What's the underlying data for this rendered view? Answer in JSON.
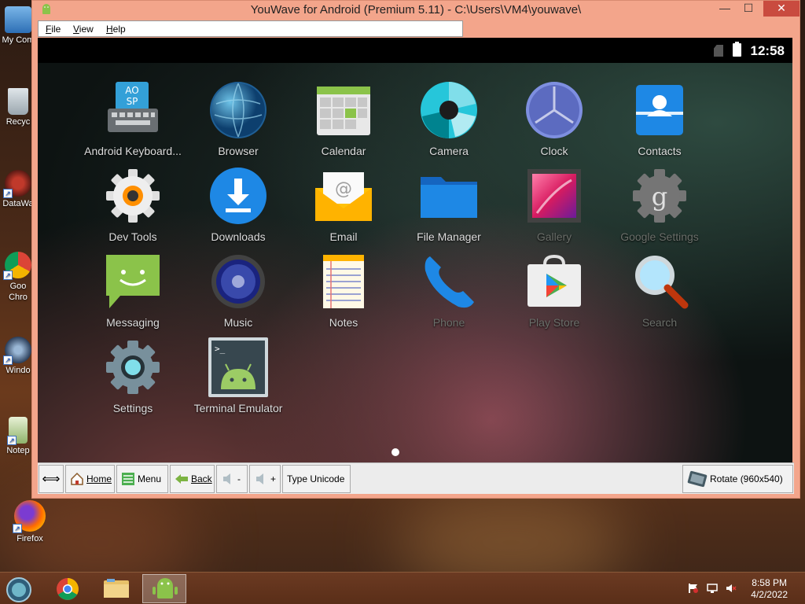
{
  "window": {
    "title": "YouWave for Android (Premium 5.11) - C:\\Users\\VM4\\youwave\\",
    "min_symbol": "—",
    "max_symbol": "☐",
    "close_symbol": "✕"
  },
  "menu": {
    "items": [
      {
        "label": "File",
        "accel": "F",
        "rest": "ile"
      },
      {
        "label": "View",
        "accel": "V",
        "rest": "iew"
      },
      {
        "label": "Help",
        "accel": "H",
        "rest": "elp"
      }
    ]
  },
  "status_bar": {
    "time": "12:58"
  },
  "apps": [
    {
      "label": "Android Keyboard...",
      "icon": "keyboard-icon",
      "dim": false
    },
    {
      "label": "Browser",
      "icon": "globe-icon",
      "dim": false
    },
    {
      "label": "Calendar",
      "icon": "calendar-icon",
      "dim": false
    },
    {
      "label": "Camera",
      "icon": "camera-icon",
      "dim": false
    },
    {
      "label": "Clock",
      "icon": "clock-icon",
      "dim": false
    },
    {
      "label": "Contacts",
      "icon": "contacts-icon",
      "dim": false
    },
    {
      "label": "Dev Tools",
      "icon": "gear-icon",
      "dim": false
    },
    {
      "label": "Downloads",
      "icon": "download-icon",
      "dim": false
    },
    {
      "label": "Email",
      "icon": "email-icon",
      "dim": false
    },
    {
      "label": "File Manager",
      "icon": "folder-icon",
      "dim": false
    },
    {
      "label": "Gallery",
      "icon": "gallery-icon",
      "dim": true
    },
    {
      "label": "Google Settings",
      "icon": "google-settings-icon",
      "dim": true
    },
    {
      "label": "Messaging",
      "icon": "messaging-icon",
      "dim": false
    },
    {
      "label": "Music",
      "icon": "speaker-icon",
      "dim": false
    },
    {
      "label": "Notes",
      "icon": "notes-icon",
      "dim": false
    },
    {
      "label": "Phone",
      "icon": "phone-icon",
      "dim": true
    },
    {
      "label": "Play Store",
      "icon": "play-store-icon",
      "dim": true
    },
    {
      "label": "Search",
      "icon": "magnifier-icon",
      "dim": true
    },
    {
      "label": "Settings",
      "icon": "settings-icon",
      "dim": false
    },
    {
      "label": "Terminal Emulator",
      "icon": "terminal-icon",
      "dim": false
    }
  ],
  "toolbar": {
    "home": "Home",
    "menu": "Menu",
    "back": "Back",
    "vol_down": "-",
    "vol_up": "+",
    "type_unicode": "Type Unicode",
    "rotate": "Rotate (960x540)"
  },
  "desktop_icons": [
    {
      "label": "My Com",
      "icon": "computer-icon"
    },
    {
      "label": "Recyc",
      "icon": "recycle-bin-icon"
    },
    {
      "label": "DataWa",
      "icon": "datawave-icon"
    },
    {
      "label": "Goo\nChro",
      "icon": "chrome-icon"
    },
    {
      "label": "Windo",
      "icon": "windows-icon"
    },
    {
      "label": "Notep",
      "icon": "notepad-icon"
    },
    {
      "label": "Firefox",
      "icon": "firefox-icon"
    }
  ],
  "taskbar": {
    "time": "8:58 PM",
    "date": "4/2/2022"
  }
}
